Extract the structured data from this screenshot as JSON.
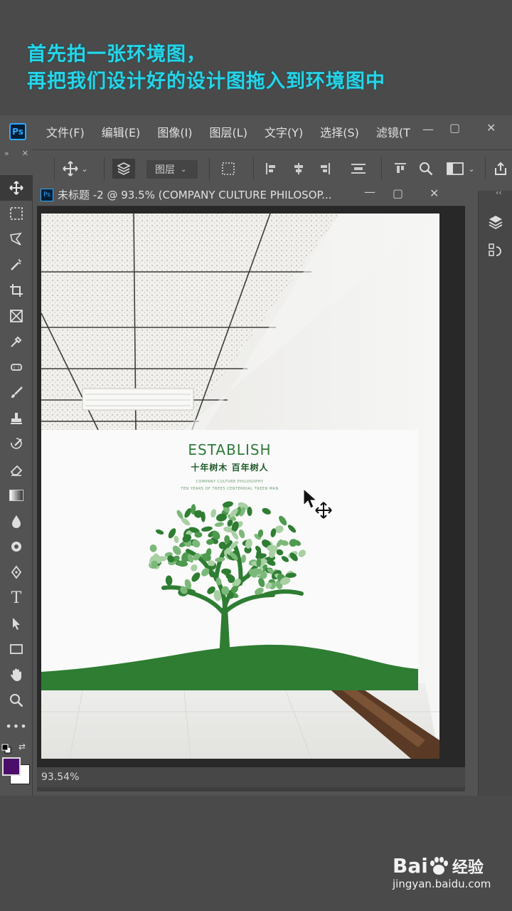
{
  "caption": {
    "line1": "首先拍一张环境图，",
    "line2": "再把我们设计好的设计图拖入到环境图中"
  },
  "app": {
    "logo": "Ps",
    "menus": [
      "文件(F)",
      "编辑(E)",
      "图像(I)",
      "图层(L)",
      "文字(Y)",
      "选择(S)",
      "滤镜(T"
    ],
    "window_controls": {
      "minimize": "—",
      "restore": "▢",
      "close": "✕"
    }
  },
  "options_bar": {
    "layer_dropdown": "图层",
    "icons": [
      "move-icon",
      "auto-select-icon",
      "layer-dropdown",
      "transform-controls-icon",
      "align-left-icon",
      "align-center-icon",
      "align-right-icon",
      "align-top-icon",
      "distribute-icon",
      "search-icon",
      "workspace-icon",
      "share-icon"
    ]
  },
  "toolbar": {
    "collapse": "»",
    "close": "✕",
    "tools": [
      "move-tool",
      "marquee-tool",
      "lasso-tool",
      "magic-wand-tool",
      "crop-tool",
      "frame-tool",
      "eyedropper-tool",
      "spot-healing-tool",
      "brush-tool",
      "clone-stamp-tool",
      "history-brush-tool",
      "eraser-tool",
      "gradient-tool",
      "blur-tool",
      "dodge-tool",
      "pen-tool",
      "type-tool",
      "path-selection-tool",
      "rectangle-tool",
      "hand-tool",
      "zoom-tool",
      "more-tools"
    ],
    "foreground_color": "#4b0f6b",
    "background_color": "#ffffff"
  },
  "document": {
    "icon": "Ps",
    "title": "未标题 -2 @ 93.5% (COMPANY CULTURE  PHILOSOP...",
    "zoom": "93.54%"
  },
  "poster": {
    "title": "ESTABLISH",
    "subtitle": "十年树木 百年树人",
    "line1": "COMPANY CULTURE  PHILOSOPHY",
    "line2": "TEN YEARS OF TREES CENTERNIAL TREEN MAN",
    "green": "#2e7d32"
  },
  "right_panel": {
    "collapse": "‹‹",
    "icons": [
      "layers-icon",
      "history-icon"
    ]
  },
  "watermark": {
    "brand": "Bai",
    "brand2": "经验",
    "url": "jingyan.baidu.com"
  }
}
